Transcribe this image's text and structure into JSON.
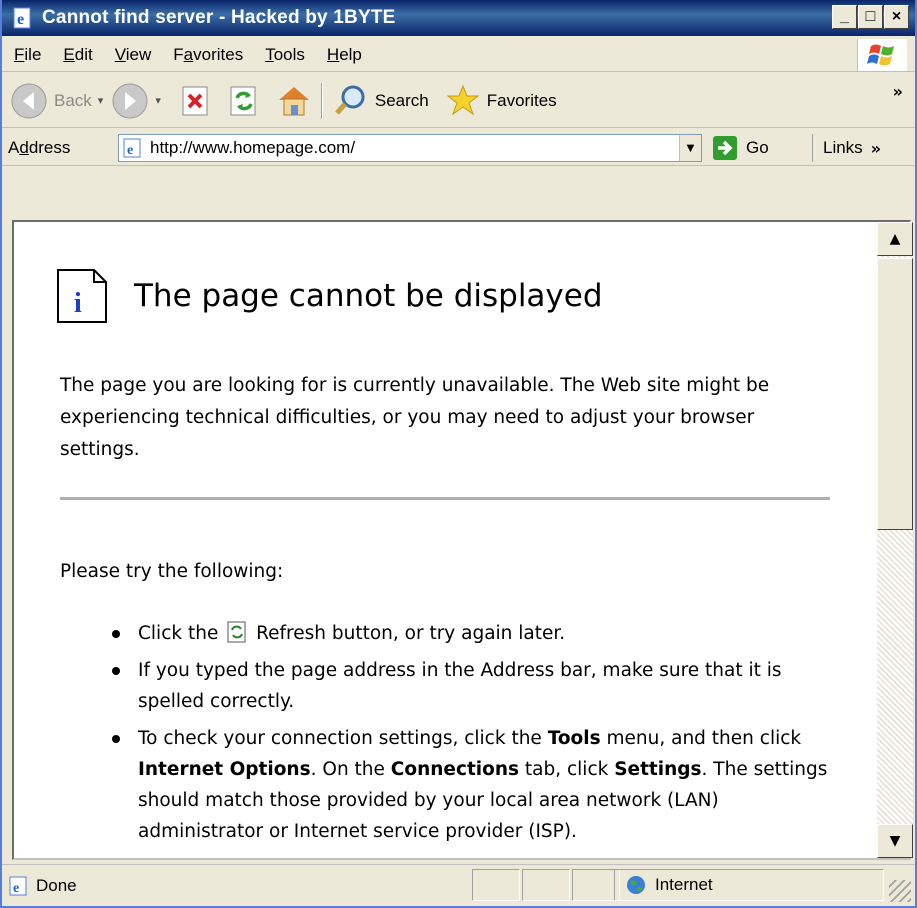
{
  "window": {
    "title": "Cannot find server - Hacked by 1BYTE",
    "minimize": "_",
    "maximize": "□",
    "close": "×"
  },
  "menubar": {
    "items": [
      {
        "label": "File",
        "key": "F",
        "rest": "ile"
      },
      {
        "label": "Edit",
        "key": "E",
        "rest": "dit"
      },
      {
        "label": "View",
        "key": "V",
        "rest": "iew"
      },
      {
        "label": "Favorites",
        "pre": "F",
        "key": "a",
        "rest": "vorites"
      },
      {
        "label": "Tools",
        "key": "T",
        "rest": "ools"
      },
      {
        "label": "Help",
        "key": "H",
        "rest": "elp"
      }
    ]
  },
  "toolbar": {
    "back_label": "Back",
    "search_label": "Search",
    "favorites_label": "Favorites",
    "overflow": "»"
  },
  "addressbar": {
    "label_pre": "A",
    "label_key": "d",
    "label_rest": "dress",
    "url": "http://www.homepage.com/",
    "go_label": "Go",
    "links_label": "Links",
    "links_overflow": "»"
  },
  "page": {
    "title": "The page cannot be displayed",
    "intro": "The page you are looking for is currently unavailable. The Web site might be experiencing technical difficulties, or you may need to adjust your browser settings.",
    "try_label": "Please try the following:",
    "bullet1_pre": "Click the",
    "bullet1_post": "Refresh button, or try again later.",
    "bullet2": "If you typed the page address in the Address bar, make sure that it is spelled correctly.",
    "bullet3_a": "To check your connection settings, click the ",
    "bullet3_tools": "Tools",
    "bullet3_b": " menu, and then click ",
    "bullet3_io": "Internet Options",
    "bullet3_c": ". On the ",
    "bullet3_conn": "Connections",
    "bullet3_d": " tab, click ",
    "bullet3_settings": "Settings",
    "bullet3_e": ". The settings should match those provided by your local area network (LAN) administrator or Internet service provider (ISP)."
  },
  "statusbar": {
    "status": "Done",
    "zone": "Internet"
  },
  "colors": {
    "titlebar": "#0a246a",
    "chrome": "#ece9d8",
    "go_green": "#2f9e2f"
  }
}
